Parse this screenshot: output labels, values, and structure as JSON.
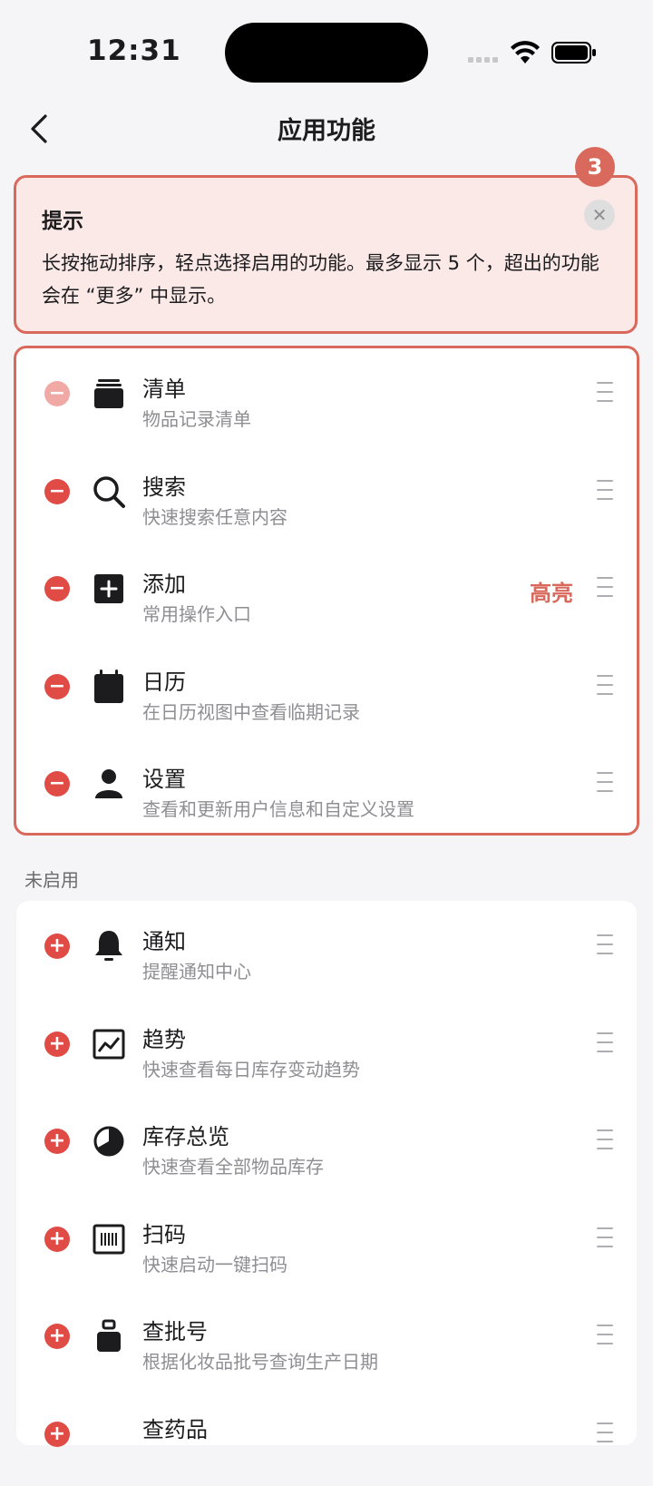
{
  "status_bar": {
    "time": "12:31"
  },
  "nav": {
    "title": "应用功能"
  },
  "tip": {
    "badge": "3",
    "title": "提示",
    "body": "长按拖动排序，轻点选择启用的功能。最多显示 5 个，超出的功能会在 “更多” 中显示。",
    "close_glyph": "✕"
  },
  "enabled": {
    "items": [
      {
        "name": "清单",
        "desc": "物品记录清单",
        "icon": "stack-icon",
        "status": "−"
      },
      {
        "name": "搜索",
        "desc": "快速搜索任意内容",
        "icon": "search-icon",
        "status": "−"
      },
      {
        "name": "添加",
        "desc": "常用操作入口",
        "icon": "add-square-icon",
        "status": "−",
        "highlight": "高亮"
      },
      {
        "name": "日历",
        "desc": "在日历视图中查看临期记录",
        "icon": "calendar-icon",
        "status": "−"
      },
      {
        "name": "设置",
        "desc": "查看和更新用户信息和自定义设置",
        "icon": "user-icon",
        "status": "−"
      }
    ]
  },
  "disabled": {
    "header": "未启用",
    "items": [
      {
        "name": "通知",
        "desc": "提醒通知中心",
        "icon": "bell-icon",
        "status": "+"
      },
      {
        "name": "趋势",
        "desc": "快速查看每日库存变动趋势",
        "icon": "trend-chart-icon",
        "status": "+"
      },
      {
        "name": "库存总览",
        "desc": "快速查看全部物品库存",
        "icon": "pie-chart-icon",
        "status": "+"
      },
      {
        "name": "扫码",
        "desc": "快速启动一键扫码",
        "icon": "scan-icon",
        "status": "+"
      },
      {
        "name": "查批号",
        "desc": "根据化妆品批号查询生产日期",
        "icon": "bottle-icon",
        "status": "+"
      },
      {
        "name": "查药品",
        "desc": "",
        "icon": "pill-icon",
        "status": "+"
      }
    ]
  },
  "colors": {
    "accent": "#d9695d",
    "status_red": "#e04b45",
    "tip_bg": "#fbe9e7"
  }
}
